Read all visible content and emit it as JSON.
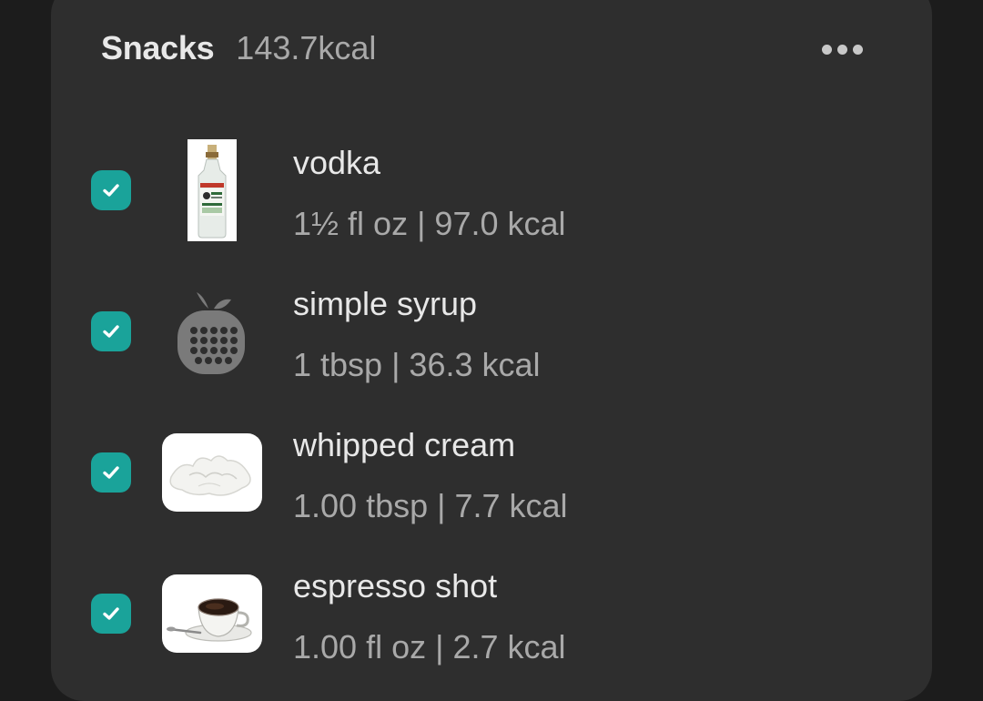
{
  "meal": {
    "title": "Snacks",
    "total_kcal": "143.7kcal",
    "more_icon": "more-horizontal-icon"
  },
  "colors": {
    "background": "#1c1c1c",
    "card": "#2e2e2e",
    "check": "#1aa39a",
    "primary_text": "#e8e8e8",
    "secondary_text": "#a9a9a9"
  },
  "items": [
    {
      "name": "vodka",
      "detail": "1½ fl oz | 97.0 kcal",
      "checked": true,
      "thumbnail": "vodka-bottle-image"
    },
    {
      "name": "simple syrup",
      "detail": "1 tbsp | 36.3 kcal",
      "checked": true,
      "thumbnail": "calculator-apple-icon"
    },
    {
      "name": "whipped cream",
      "detail": "1.00 tbsp | 7.7 kcal",
      "checked": true,
      "thumbnail": "whipped-cream-image"
    },
    {
      "name": "espresso shot",
      "detail": "1.00 fl oz | 2.7 kcal",
      "checked": true,
      "thumbnail": "espresso-cup-image"
    }
  ]
}
